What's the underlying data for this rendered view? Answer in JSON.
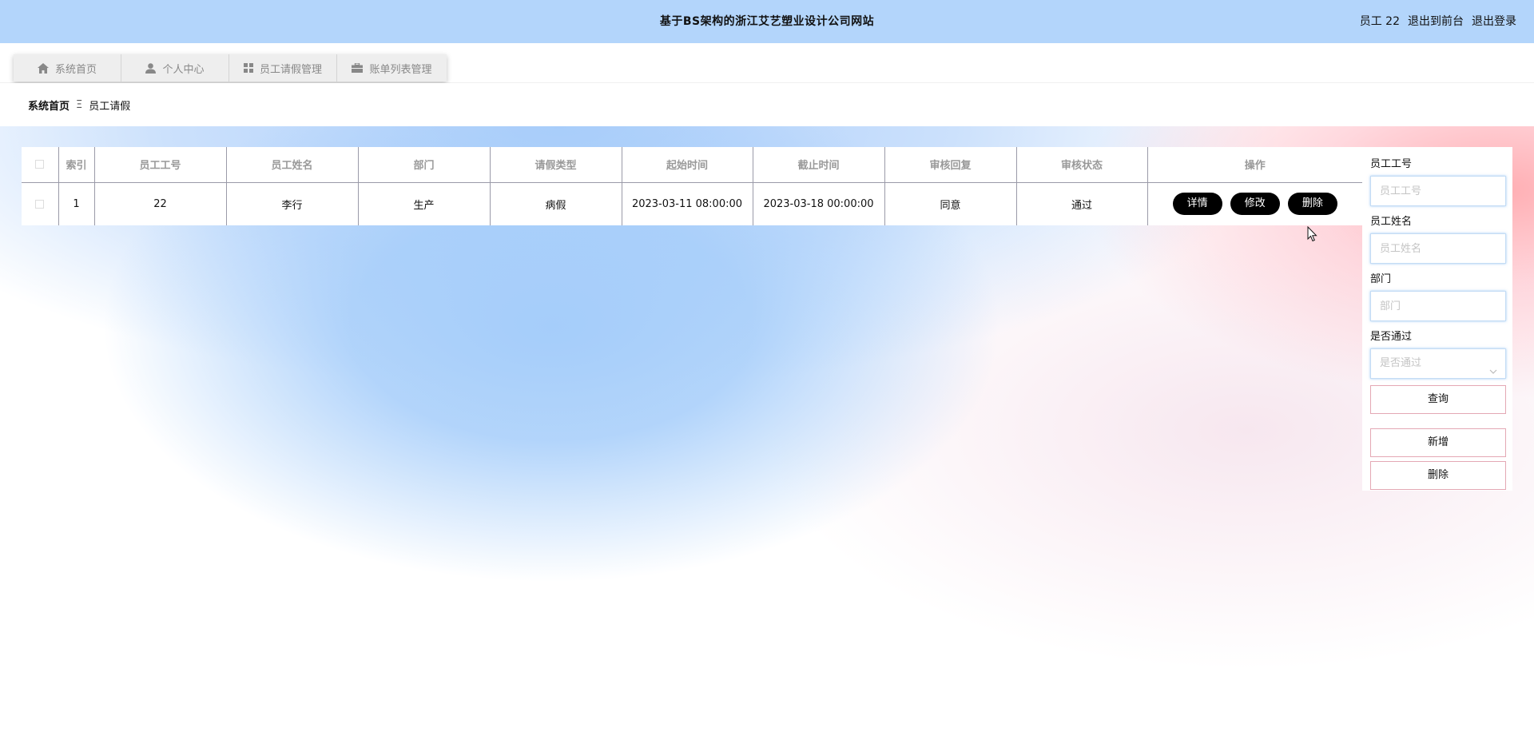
{
  "header": {
    "title": "基于BS架构的浙江艾艺塑业设计公司网站",
    "user_label": "员工 22",
    "back_to_front": "退出到前台",
    "logout": "退出登录"
  },
  "nav": {
    "tabs": [
      {
        "label": "系统首页",
        "icon": "home-icon"
      },
      {
        "label": "个人中心",
        "icon": "user-icon"
      },
      {
        "label": "员工请假管理",
        "icon": "grid-icon"
      },
      {
        "label": "账单列表管理",
        "icon": "briefcase-icon"
      }
    ]
  },
  "breadcrumb": {
    "home": "系统首页",
    "separator": "Ξ",
    "current": "员工请假"
  },
  "table": {
    "columns": [
      "索引",
      "员工工号",
      "员工姓名",
      "部门",
      "请假类型",
      "起始时间",
      "截止时间",
      "审核回复",
      "审核状态",
      "操作"
    ],
    "rows": [
      {
        "index": "1",
        "emp_no": "22",
        "emp_name": "李行",
        "dept": "生产",
        "leave_type": "病假",
        "start": "2023-03-11 08:00:00",
        "end": "2023-03-18 00:00:00",
        "reply": "同意",
        "status": "通过"
      }
    ],
    "actions": {
      "detail": "详情",
      "edit": "修改",
      "delete": "删除"
    }
  },
  "search": {
    "emp_no_label": "员工工号",
    "emp_no_placeholder": "员工工号",
    "emp_name_label": "员工姓名",
    "emp_name_placeholder": "员工姓名",
    "dept_label": "部门",
    "dept_placeholder": "部门",
    "passed_label": "是否通过",
    "passed_placeholder": "是否通过",
    "query_button": "查询",
    "add_button": "新增",
    "delete_button": "删除"
  },
  "colors": {
    "header_bg": "#b3d5fb",
    "button_black": "#000000",
    "side_button_border": "#e4a8b4"
  }
}
